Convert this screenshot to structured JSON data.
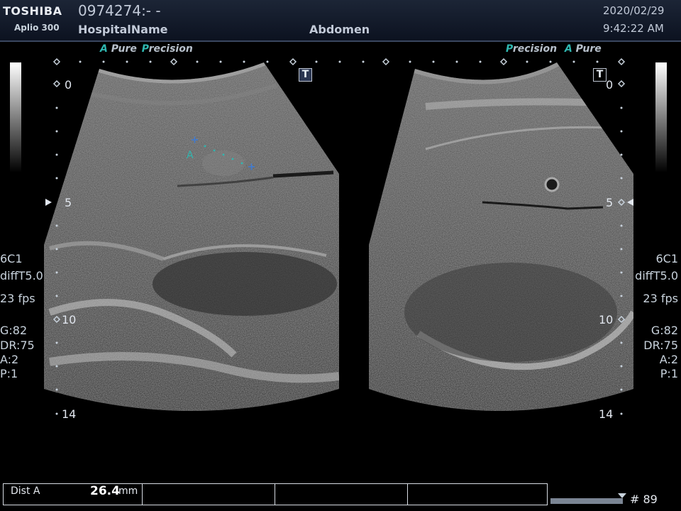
{
  "header": {
    "brand": "TOSHIBA",
    "model": "Aplio 300",
    "patient_id": "0974274:- -",
    "hospital": "HospitalName",
    "exam": "Abdomen",
    "date": "2020/02/29",
    "time": "9:42:22 AM"
  },
  "left_panel": {
    "mode_a": "A",
    "mode_pure": "Pure",
    "mode_p": "P",
    "mode_precision": "recision",
    "probe": "6C1",
    "preset": "diffT5.0",
    "fps": "23 fps",
    "gain": "G:82",
    "dynamic_range": "DR:75",
    "acoustic": "A:2",
    "persistence": "P:1",
    "depth_marks": [
      "0",
      "5",
      "10",
      "14"
    ],
    "caliper_label": "A",
    "t_marker": "T"
  },
  "right_panel": {
    "mode_p": "P",
    "mode_precision": "recision",
    "mode_a": "A",
    "mode_pure": "Pure",
    "probe": "6C1",
    "preset": "diffT5.0",
    "fps": "23 fps",
    "gain": "G:82",
    "dynamic_range": "DR:75",
    "acoustic": "A:2",
    "persistence": "P:1",
    "depth_marks": [
      "0",
      "5",
      "10",
      "14"
    ],
    "t_marker": "T"
  },
  "measurement": {
    "label": "Dist A",
    "value": "26.4",
    "unit": "mm"
  },
  "cine": {
    "frame": "# 89"
  },
  "colors": {
    "accent_teal": "#2fb7b0",
    "caliper_blue": "#3d7bd6",
    "header_bg": "#1c2536"
  }
}
